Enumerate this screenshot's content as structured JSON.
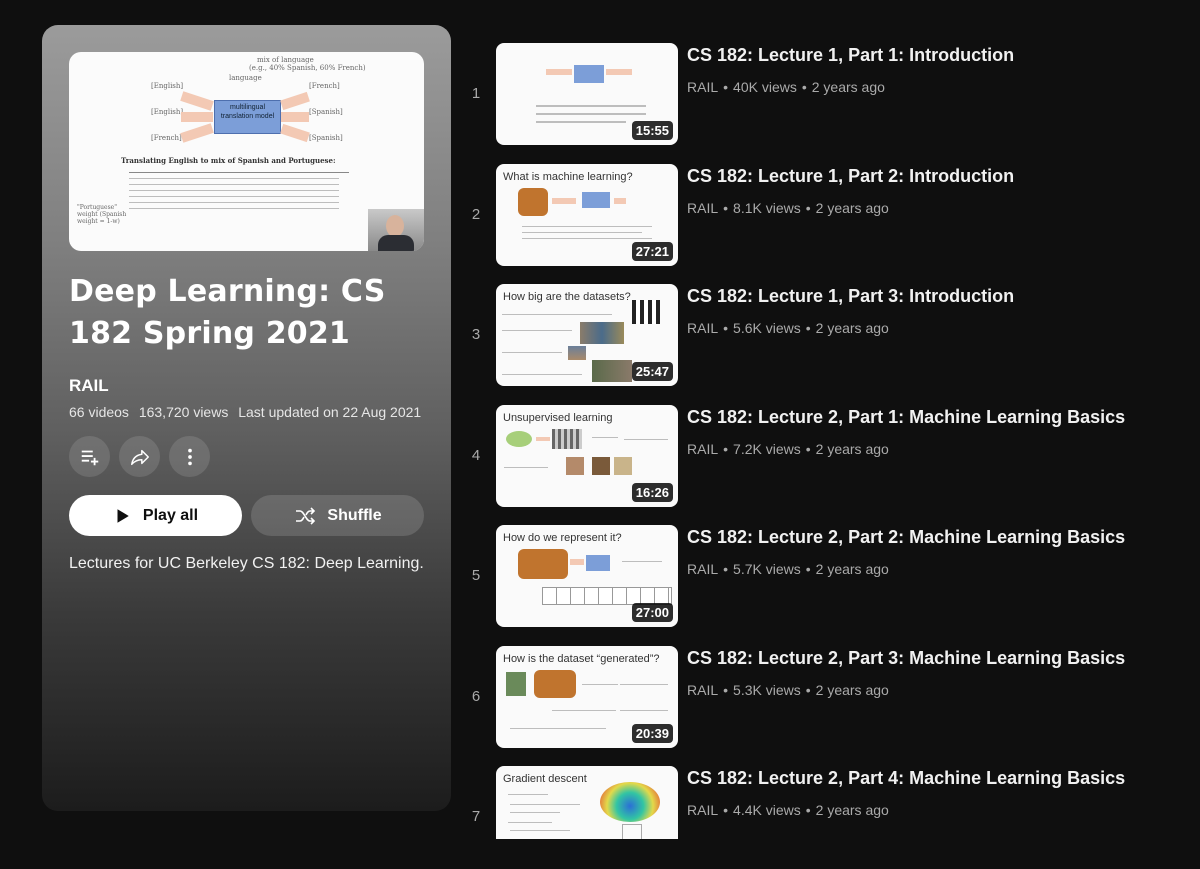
{
  "playlist": {
    "title": "Deep Learning: CS 182 Spring 2021",
    "owner": "RAIL",
    "video_count": "66 videos",
    "views": "163,720 views",
    "updated": "Last updated on 22 Aug 2021",
    "play_all_label": "Play all",
    "shuffle_label": "Shuffle",
    "description": "Lectures for UC Berkeley CS 182: Deep Learning.",
    "thumb": {
      "mix_label": "mix of language",
      "mix_detail": "(e.g., 40% Spanish, 60% French)",
      "language_word": "language",
      "center_label": "multilingual translation model",
      "in1": "[English]",
      "in2": "[English]",
      "in3": "[French]",
      "out1": "[French]",
      "out2": "[Spanish]",
      "out3": "[Spanish]",
      "table_title": "Translating English to mix of Spanish and Portuguese:",
      "weight_label": "\"Portuguese\" weight (Spanish weight = 1-w)"
    }
  },
  "videos": [
    {
      "index": "1",
      "title": "CS 182: Lecture 1, Part 1: Introduction",
      "channel": "RAIL",
      "views": "40K views",
      "age": "2 years ago",
      "duration": "15:55",
      "slide_title": ""
    },
    {
      "index": "2",
      "title": "CS 182: Lecture 1, Part 2: Introduction",
      "channel": "RAIL",
      "views": "8.1K views",
      "age": "2 years ago",
      "duration": "27:21",
      "slide_title": "What is machine learning?"
    },
    {
      "index": "3",
      "title": "CS 182: Lecture 1, Part 3: Introduction",
      "channel": "RAIL",
      "views": "5.6K views",
      "age": "2 years ago",
      "duration": "25:47",
      "slide_title": "How big are the datasets?"
    },
    {
      "index": "4",
      "title": "CS 182: Lecture 2, Part 1: Machine Learning Basics",
      "channel": "RAIL",
      "views": "7.2K views",
      "age": "2 years ago",
      "duration": "16:26",
      "slide_title": "Unsupervised learning"
    },
    {
      "index": "5",
      "title": "CS 182: Lecture 2, Part 2: Machine Learning Basics",
      "channel": "RAIL",
      "views": "5.7K views",
      "age": "2 years ago",
      "duration": "27:00",
      "slide_title": "How do we represent it?"
    },
    {
      "index": "6",
      "title": "CS 182: Lecture 2, Part 3: Machine Learning Basics",
      "channel": "RAIL",
      "views": "5.3K views",
      "age": "2 years ago",
      "duration": "20:39",
      "slide_title": "How is the dataset “generated”?"
    },
    {
      "index": "7",
      "title": "CS 182: Lecture 2, Part 4: Machine Learning Basics",
      "channel": "RAIL",
      "views": "4.4K views",
      "age": "2 years ago",
      "duration": "",
      "slide_title": "Gradient descent"
    }
  ],
  "icons": {
    "save": "playlist-add-icon",
    "share": "share-icon",
    "more": "more-vertical-icon",
    "play": "play-icon",
    "shuffle": "shuffle-icon"
  },
  "colors": {
    "background": "#0f0f0f",
    "duration_badge": "#000000",
    "meta_text": "#aaaaaa",
    "slide_box": "#7c9ed8",
    "slide_arrow": "#f3c9b4"
  }
}
